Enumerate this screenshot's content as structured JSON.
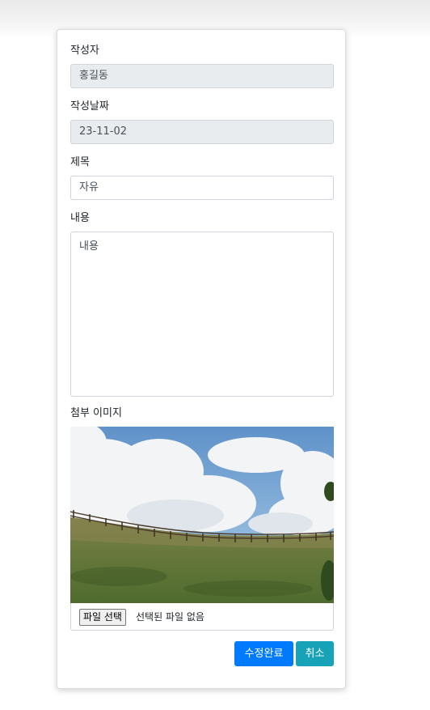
{
  "form": {
    "author": {
      "label": "작성자",
      "value": "홍길동"
    },
    "date": {
      "label": "작성날짜",
      "value": "23-11-02"
    },
    "title": {
      "label": "제목",
      "value": "자유"
    },
    "content": {
      "label": "내용",
      "value": "내용"
    },
    "attachment": {
      "label": "첨부 이미지",
      "file_button": "파일 선택",
      "file_status": "선택된 파일 없음"
    }
  },
  "actions": {
    "save_label": "수정완료",
    "cancel_label": "취소"
  },
  "colors": {
    "primary": "#007bff",
    "info": "#17a2b8",
    "readonly_bg": "#e9ecef",
    "border": "#ced4da"
  }
}
